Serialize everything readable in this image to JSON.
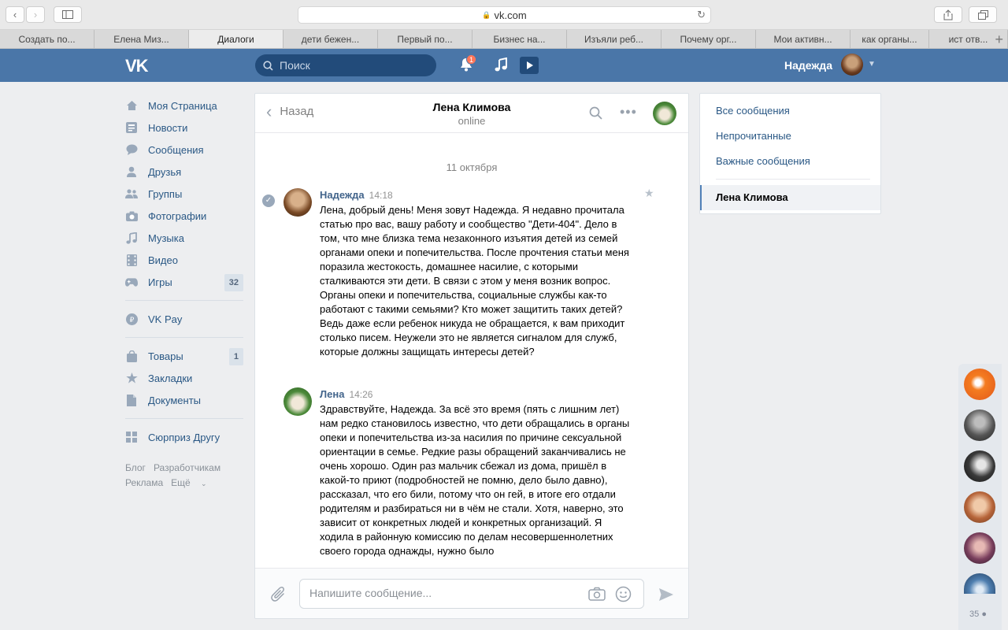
{
  "browser": {
    "url": "vk.com",
    "tabs": [
      "Создать по...",
      "Елена Миз...",
      "Диалоги",
      "дети бежен...",
      "Первый по...",
      "Бизнес на...",
      "Изъяли реб...",
      "Почему орг...",
      "Мои активн...",
      "как органы...",
      "ист отв..."
    ],
    "active_tab_index": 2
  },
  "header": {
    "search_placeholder": "Поиск",
    "notifications_count": "1",
    "user_name": "Надежда"
  },
  "left_menu": {
    "items": [
      {
        "label": "Моя Страница",
        "icon": "home-icon"
      },
      {
        "label": "Новости",
        "icon": "news-icon"
      },
      {
        "label": "Сообщения",
        "icon": "messages-icon"
      },
      {
        "label": "Друзья",
        "icon": "friends-icon"
      },
      {
        "label": "Группы",
        "icon": "groups-icon"
      },
      {
        "label": "Фотографии",
        "icon": "camera-icon"
      },
      {
        "label": "Музыка",
        "icon": "music-icon"
      },
      {
        "label": "Видео",
        "icon": "video-icon"
      },
      {
        "label": "Игры",
        "icon": "games-icon",
        "count": "32"
      }
    ],
    "vkpay": "VK Pay",
    "items2": [
      {
        "label": "Товары",
        "icon": "bag-icon",
        "count": "1"
      },
      {
        "label": "Закладки",
        "icon": "star-icon"
      },
      {
        "label": "Документы",
        "icon": "document-icon"
      }
    ],
    "surprise": "Сюрприз Другу",
    "footer": {
      "blog": "Блог",
      "developers": "Разработчикам",
      "ads": "Реклама",
      "more": "Ещё"
    }
  },
  "chat": {
    "back_label": "Назад",
    "peer_name": "Лена Климова",
    "peer_status": "online",
    "date_separator": "11 октября",
    "messages": [
      {
        "author": "Надежда",
        "time": "14:18",
        "text": "Лена, добрый день! Меня зовут Надежда. Я недавно прочитала статью про вас, вашу работу и сообщество \"Дети-404\". Дело в том, что мне близка тема незаконного изъятия детей из семей органами опеки и попечительства. После прочтения статьи меня поразила жестокость, домашнее насилие, с которыми сталкиваются эти дети. В связи с этом у меня возник вопрос. Органы опеки и попечительства, социальные службы как-то работают с такими семьями? Кто может защитить таких детей? Ведь даже если ребенок никуда не обращается, к вам приходит столько писем. Неужели это не является сигналом для служб, которые должны защищать интересы детей?"
      },
      {
        "author": "Лена",
        "time": "14:26",
        "text": "Здравствуйте, Надежда. За всё это время (пять с лишним лет) нам редко становилось известно, что дети обращались в органы опеки и попечительства из-за насилия по причине сексуальной ориентации в семье. Редкие разы обращений заканчивались не очень хорошо. Один раз мальчик сбежал из дома, пришёл в какой-то приют (подробностей не помню, дело было давно), рассказал, что его били, потому что он гей, в итоге его отдали родителям и разбираться ни в чём не стали. Хотя, наверно, это зависит от конкретных людей и конкретных организаций. Я ходила в районную комиссию по делам несовершеннолетних своего города однажды, нужно было"
      }
    ],
    "input_placeholder": "Напишите сообщение..."
  },
  "folders": {
    "all": "Все сообщения",
    "unread": "Непрочитанные",
    "important": "Важные сообщения",
    "active": "Лена Климова"
  },
  "chatbar": {
    "online_count": "35"
  }
}
